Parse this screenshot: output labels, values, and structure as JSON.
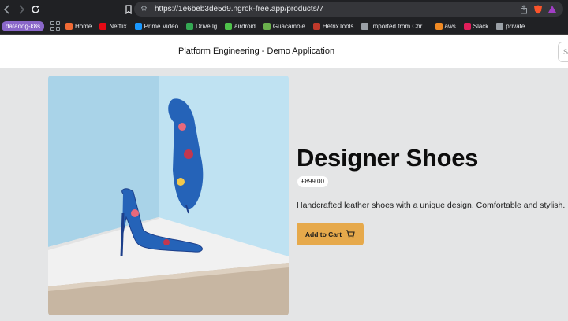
{
  "browser": {
    "url": "https://1e6beb3de5d9.ngrok-free.app/products/7",
    "profile_label": "datadog-k8s",
    "bookmarks": [
      {
        "label": "Home",
        "icon": "home-favicon",
        "color": "#f06a35"
      },
      {
        "label": "Netflix",
        "icon": "netflix-favicon",
        "color": "#e50914"
      },
      {
        "label": "Prime Video",
        "icon": "prime-video-favicon",
        "color": "#1a98ff"
      },
      {
        "label": "Drive lg",
        "icon": "drive-favicon",
        "color": "#34a853"
      },
      {
        "label": "airdroid",
        "icon": "airdroid-favicon",
        "color": "#4ec14a"
      },
      {
        "label": "Guacamole",
        "icon": "guacamole-favicon",
        "color": "#6ab04c"
      },
      {
        "label": "HetrixTools",
        "icon": "hetrixtools-favicon",
        "color": "#c0392b"
      },
      {
        "label": "Imported from Chr...",
        "icon": "folder-icon",
        "color": "#9aa0a6"
      },
      {
        "label": "aws",
        "icon": "aws-favicon",
        "color": "#f08a24"
      },
      {
        "label": "Slack",
        "icon": "slack-favicon",
        "color": "#e01e5a"
      },
      {
        "label": "private",
        "icon": "folder-icon",
        "color": "#9aa0a6"
      }
    ]
  },
  "header": {
    "title": "Platform Engineering - Demo Application",
    "search_stub": "S"
  },
  "product": {
    "title": "Designer Shoes",
    "price": "£899.00",
    "description": "Handcrafted leather shoes with a unique design. Comfortable and stylish.",
    "add_to_cart_label": "Add to Cart",
    "accent_color": "#e6a94b"
  }
}
